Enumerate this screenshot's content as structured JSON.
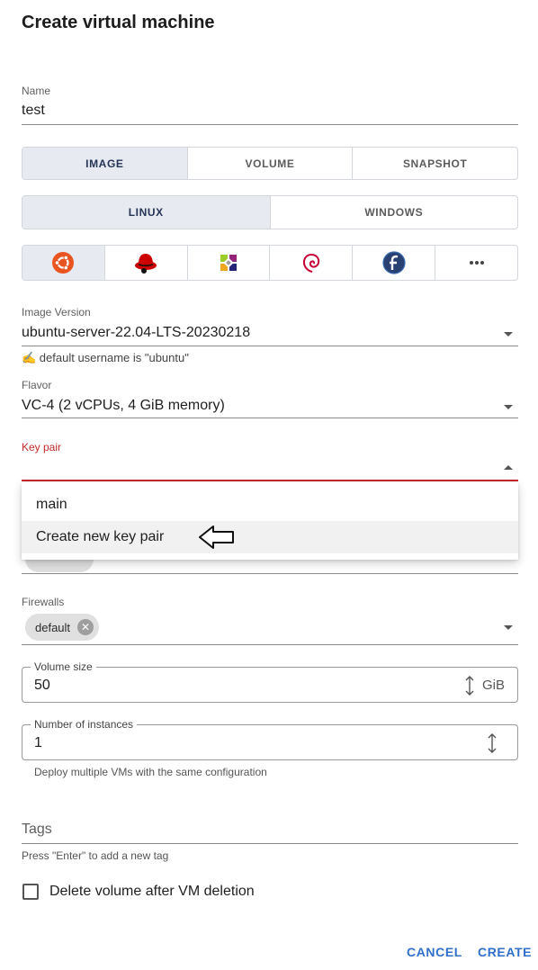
{
  "dialog": {
    "title": "Create virtual machine"
  },
  "name_field": {
    "label": "Name",
    "value": "test"
  },
  "source_tabs": [
    {
      "label": "IMAGE",
      "active": true
    },
    {
      "label": "VOLUME",
      "active": false
    },
    {
      "label": "SNAPSHOT",
      "active": false
    }
  ],
  "os_family_tabs": [
    {
      "label": "LINUX",
      "active": true
    },
    {
      "label": "WINDOWS",
      "active": false
    }
  ],
  "distros": [
    {
      "icon": "ubuntu-icon",
      "active": true
    },
    {
      "icon": "redhat-icon",
      "active": false
    },
    {
      "icon": "centos-icon",
      "active": false
    },
    {
      "icon": "debian-icon",
      "active": false
    },
    {
      "icon": "fedora-icon",
      "active": false
    },
    {
      "icon": "more-icon",
      "active": false
    }
  ],
  "image_version": {
    "label": "Image Version",
    "value": "ubuntu-server-22.04-LTS-20230218",
    "hint": "✍ default username is \"ubuntu\""
  },
  "flavor": {
    "label": "Flavor",
    "value": "VC-4 (2 vCPUs, 4 GiB memory)"
  },
  "key_pair": {
    "label": "Key pair",
    "value": "",
    "options": [
      "main",
      "Create new key pair"
    ]
  },
  "firewalls": {
    "label": "Firewalls",
    "chips": [
      "default"
    ]
  },
  "volume_size": {
    "label": "Volume size",
    "value": "50",
    "unit": "GiB"
  },
  "instances": {
    "label": "Number of instances",
    "value": "1",
    "helper": "Deploy multiple VMs with the same configuration"
  },
  "tags": {
    "label": "Tags",
    "helper": "Press \"Enter\" to add a new tag"
  },
  "delete_volume": {
    "label": "Delete volume after VM deletion",
    "checked": false
  },
  "actions": {
    "cancel": "CANCEL",
    "create": "CREATE"
  },
  "colors": {
    "accent": "#2f6fcb",
    "error": "#c62828",
    "selected_bg": "#e7eaf0"
  }
}
